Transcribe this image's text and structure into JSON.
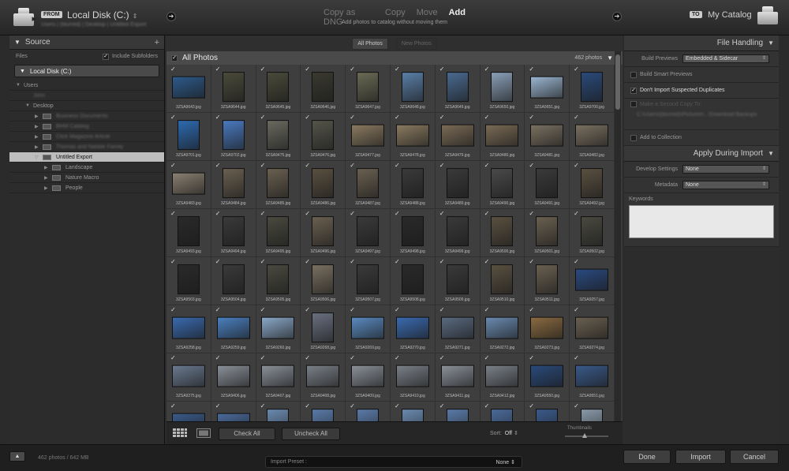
{
  "header": {
    "from_badge": "FROM",
    "from_location": "Local Disk (C:)",
    "from_path": "Users | (blurred) | Desktop | Untitled Export",
    "modes": [
      "Copy as DNG",
      "Copy",
      "Move",
      "Add"
    ],
    "active_mode": "Add",
    "mode_description": "Add photos to catalog without moving them",
    "to_badge": "TO",
    "to_location": "My Catalog"
  },
  "source": {
    "title": "Source",
    "files_label": "Files",
    "include_subfolders": "Include Subfolders",
    "volume": "Local Disk (C:)",
    "tree": [
      {
        "label": "Users",
        "depth": 0,
        "tri": "▼",
        "folder": false
      },
      {
        "label": "John",
        "depth": 1,
        "tri": "",
        "folder": false,
        "blur": true
      },
      {
        "label": "Desktop",
        "depth": 1,
        "tri": "▼",
        "folder": false
      },
      {
        "label": "Business Documents",
        "depth": 2,
        "tri": "▶",
        "folder": true,
        "blur": true
      },
      {
        "label": "BHM Catalog",
        "depth": 2,
        "tri": "▶",
        "folder": true,
        "blur": true
      },
      {
        "label": "Click Magazine Article",
        "depth": 2,
        "tri": "▶",
        "folder": true,
        "blur": true
      },
      {
        "label": "Thomas and Natalie Family",
        "depth": 2,
        "tri": "▶",
        "folder": true,
        "blur": true
      },
      {
        "label": "Untitled Export",
        "depth": 2,
        "tri": "▽",
        "folder": true,
        "selected": true
      },
      {
        "label": "Landscape",
        "depth": 3,
        "tri": "▶",
        "folder": true
      },
      {
        "label": "Nature Macro",
        "depth": 3,
        "tri": "▶",
        "folder": true
      },
      {
        "label": "People",
        "depth": 3,
        "tri": "▶",
        "folder": true
      }
    ]
  },
  "grid": {
    "tabs": [
      "All Photos",
      "New Photos"
    ],
    "active_tab": "All Photos",
    "title": "All Photos",
    "count": "462 photos",
    "photos": [
      {
        "n": "3ZSA9643.jpg",
        "o": "l",
        "c": "#2d5a8a"
      },
      {
        "n": "3ZSA9644.jpg",
        "o": "p",
        "c": "#4a4a3a"
      },
      {
        "n": "3ZSA9645.jpg",
        "o": "p",
        "c": "#4a4a3a"
      },
      {
        "n": "3ZSA9646.jpg",
        "o": "p",
        "c": "#3a3a30"
      },
      {
        "n": "3ZSA9647.jpg",
        "o": "p",
        "c": "#6a6a55"
      },
      {
        "n": "3ZSA9648.jpg",
        "o": "p",
        "c": "#5a7fa8"
      },
      {
        "n": "3ZSA9649.jpg",
        "o": "p",
        "c": "#4a6a90"
      },
      {
        "n": "3ZSA9650.jpg",
        "o": "p",
        "c": "#8aa0b8"
      },
      {
        "n": "3ZSA9651.jpg",
        "o": "l",
        "c": "#9ab5d0"
      },
      {
        "n": "3ZSA9700.jpg",
        "o": "p",
        "c": "#2a4a7a"
      },
      {
        "n": "3ZSA9701.jpg",
        "o": "p",
        "c": "#2d6ab0"
      },
      {
        "n": "3ZSA9702.jpg",
        "o": "p",
        "c": "#4a7ac0"
      },
      {
        "n": "3ZSA9475.jpg",
        "o": "p",
        "c": "#6a6a60"
      },
      {
        "n": "3ZSA9476.jpg",
        "o": "p",
        "c": "#55554a"
      },
      {
        "n": "3ZSA9477.jpg",
        "o": "l",
        "c": "#8a7a60"
      },
      {
        "n": "3ZSA9478.jpg",
        "o": "l",
        "c": "#8a7a60"
      },
      {
        "n": "3ZSA9479.jpg",
        "o": "l",
        "c": "#7a6a55"
      },
      {
        "n": "3ZSA9480.jpg",
        "o": "l",
        "c": "#7a6a55"
      },
      {
        "n": "3ZSA9481.jpg",
        "o": "l",
        "c": "#7a7060"
      },
      {
        "n": "3ZSA9482.jpg",
        "o": "l",
        "c": "#7a7060"
      },
      {
        "n": "3ZSA9483.jpg",
        "o": "l",
        "c": "#8a8070"
      },
      {
        "n": "3ZSA9484.jpg",
        "o": "p",
        "c": "#6a6050"
      },
      {
        "n": "3ZSA9485.jpg",
        "o": "p",
        "c": "#6a6050"
      },
      {
        "n": "3ZSA9486.jpg",
        "o": "p",
        "c": "#5a5040"
      },
      {
        "n": "3ZSA9487.jpg",
        "o": "p",
        "c": "#6a6050"
      },
      {
        "n": "3ZSA9488.jpg",
        "o": "p",
        "c": "#3a3a3a"
      },
      {
        "n": "3ZSA9489.jpg",
        "o": "p",
        "c": "#3a3a3a"
      },
      {
        "n": "3ZSA9490.jpg",
        "o": "p",
        "c": "#4a4a4a"
      },
      {
        "n": "3ZSA9491.jpg",
        "o": "p",
        "c": "#3a3a3a"
      },
      {
        "n": "3ZSA9492.jpg",
        "o": "p",
        "c": "#5a5040"
      },
      {
        "n": "3ZSA9493.jpg",
        "o": "p",
        "c": "#2a2a2a"
      },
      {
        "n": "3ZSA9494.jpg",
        "o": "p",
        "c": "#3a3a3a"
      },
      {
        "n": "3ZSA9495.jpg",
        "o": "p",
        "c": "#4a4a40"
      },
      {
        "n": "3ZSA9496.jpg",
        "o": "p",
        "c": "#6a6050"
      },
      {
        "n": "3ZSA9497.jpg",
        "o": "p",
        "c": "#3a3a3a"
      },
      {
        "n": "3ZSA9498.jpg",
        "o": "p",
        "c": "#2a2a2a"
      },
      {
        "n": "3ZSA9499.jpg",
        "o": "p",
        "c": "#3a3a3a"
      },
      {
        "n": "3ZSA9500.jpg",
        "o": "p",
        "c": "#5a5040"
      },
      {
        "n": "3ZSA9501.jpg",
        "o": "p",
        "c": "#6a6050"
      },
      {
        "n": "3ZSA9502.jpg",
        "o": "p",
        "c": "#4a4a40"
      },
      {
        "n": "3ZSA9503.jpg",
        "o": "p",
        "c": "#2a2a2a"
      },
      {
        "n": "3ZSA9504.jpg",
        "o": "p",
        "c": "#3a3a3a"
      },
      {
        "n": "3ZSA9505.jpg",
        "o": "p",
        "c": "#4a4a40"
      },
      {
        "n": "3ZSA9506.jpg",
        "o": "p",
        "c": "#7a7060"
      },
      {
        "n": "3ZSA9507.jpg",
        "o": "p",
        "c": "#3a3a3a"
      },
      {
        "n": "3ZSA9508.jpg",
        "o": "p",
        "c": "#2a2a2a"
      },
      {
        "n": "3ZSA9509.jpg",
        "o": "p",
        "c": "#3a3a3a"
      },
      {
        "n": "3ZSA9510.jpg",
        "o": "p",
        "c": "#5a5040"
      },
      {
        "n": "3ZSA9511.jpg",
        "o": "p",
        "c": "#6a6050"
      },
      {
        "n": "3ZSA9257.jpg",
        "o": "l",
        "c": "#2a4a80"
      },
      {
        "n": "3ZSA9258.jpg",
        "o": "l",
        "c": "#3a6ab0"
      },
      {
        "n": "3ZSA9259.jpg",
        "o": "l",
        "c": "#4a80c0"
      },
      {
        "n": "3ZSA9260.jpg",
        "o": "l",
        "c": "#8aa8c8"
      },
      {
        "n": "3ZSA9268.jpg",
        "o": "p",
        "c": "#6a7080"
      },
      {
        "n": "3ZSA9269.jpg",
        "o": "l",
        "c": "#5a8ac0"
      },
      {
        "n": "3ZSA9270.jpg",
        "o": "l",
        "c": "#3a6ab0"
      },
      {
        "n": "3ZSA9271.jpg",
        "o": "l",
        "c": "#5a6a80"
      },
      {
        "n": "3ZSA9272.jpg",
        "o": "l",
        "c": "#6a8ab0"
      },
      {
        "n": "3ZSA9273.jpg",
        "o": "l",
        "c": "#8a6a40"
      },
      {
        "n": "3ZSA9274.jpg",
        "o": "l",
        "c": "#6a6050"
      },
      {
        "n": "3ZSA9275.jpg",
        "o": "l",
        "c": "#6a7a90"
      },
      {
        "n": "3ZSA9406.jpg",
        "o": "l",
        "c": "#8a9098"
      },
      {
        "n": "3ZSA9407.jpg",
        "o": "l",
        "c": "#8a9098"
      },
      {
        "n": "3ZSA9408.jpg",
        "o": "l",
        "c": "#7a8088"
      },
      {
        "n": "3ZSA9409.jpg",
        "o": "l",
        "c": "#8a9098"
      },
      {
        "n": "3ZSA9410.jpg",
        "o": "l",
        "c": "#7a8088"
      },
      {
        "n": "3ZSA9411.jpg",
        "o": "l",
        "c": "#8a9098"
      },
      {
        "n": "3ZSA9412.jpg",
        "o": "l",
        "c": "#7a8088"
      },
      {
        "n": "3ZSA9550.jpg",
        "o": "l",
        "c": "#2a4a7a"
      },
      {
        "n": "3ZSA9551.jpg",
        "o": "l",
        "c": "#3a5a8a"
      },
      {
        "n": "",
        "o": "l",
        "c": "#3a5a8a"
      },
      {
        "n": "",
        "o": "l",
        "c": "#4a6a9a"
      },
      {
        "n": "",
        "o": "p",
        "c": "#6a8ab0"
      },
      {
        "n": "",
        "o": "p",
        "c": "#5a7aa8"
      },
      {
        "n": "",
        "o": "p",
        "c": "#5a7aa8"
      },
      {
        "n": "",
        "o": "p",
        "c": "#6a8ab0"
      },
      {
        "n": "",
        "o": "p",
        "c": "#5a7aa8"
      },
      {
        "n": "",
        "o": "p",
        "c": "#4a6a9a"
      },
      {
        "n": "",
        "o": "p",
        "c": "#3a5a8a"
      },
      {
        "n": "",
        "o": "p",
        "c": "#8a9aaa"
      }
    ]
  },
  "toolbar": {
    "check_all": "Check All",
    "uncheck_all": "Uncheck All",
    "sort_label": "Sort:",
    "sort_value": "Off",
    "thumbnails_label": "Thumbnails"
  },
  "file_handling": {
    "title": "File Handling",
    "build_previews_label": "Build Previews",
    "build_previews_value": "Embedded & Sidecar",
    "build_smart_previews": "Build Smart Previews",
    "dont_import_duplicates": "Don't Import Suspected Duplicates",
    "second_copy": "Make a Second Copy To:",
    "second_copy_path": "C:\\Users\\(blurred)\\Pictures\\...\\Download Backups",
    "add_to_collection": "Add to Collection"
  },
  "apply_during_import": {
    "title": "Apply During Import",
    "develop_label": "Develop Settings",
    "develop_value": "None",
    "metadata_label": "Metadata",
    "metadata_value": "None",
    "keywords_label": "Keywords",
    "keywords_value": ""
  },
  "footer": {
    "status": "462 photos / 642 MB",
    "preset_label": "Import Preset :",
    "preset_value": "None",
    "done": "Done",
    "import": "Import",
    "cancel": "Cancel"
  },
  "colors": {
    "accent": "#bdbdbd",
    "bg": "#2b2b2b",
    "panel": "#383838"
  }
}
